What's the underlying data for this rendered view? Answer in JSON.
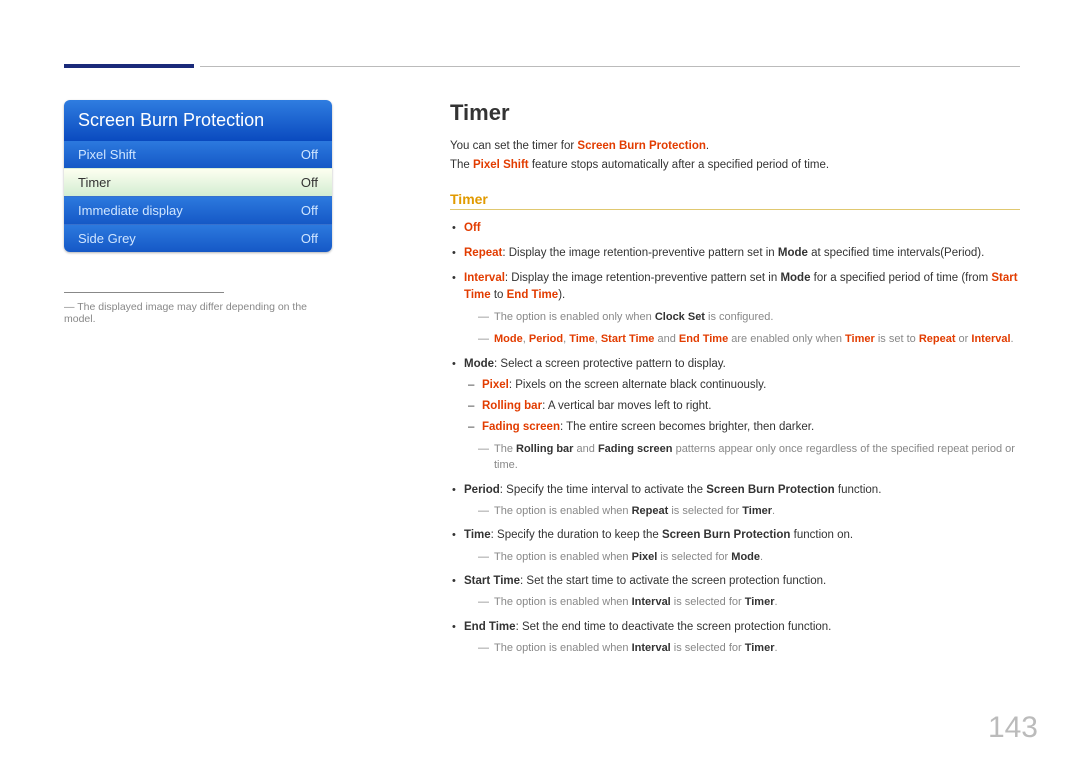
{
  "page_number": "143",
  "left": {
    "menu_title": "Screen Burn Protection",
    "rows": [
      {
        "label": "Pixel Shift",
        "value": "Off",
        "selected": false
      },
      {
        "label": "Timer",
        "value": "Off",
        "selected": true
      },
      {
        "label": "Immediate display",
        "value": "Off",
        "selected": false
      },
      {
        "label": "Side Grey",
        "value": "Off",
        "selected": false
      }
    ],
    "footnote": "The displayed image may differ depending on the model."
  },
  "right": {
    "title": "Timer",
    "intro1_pre": "You can set the timer for ",
    "intro1_b": "Screen Burn Protection",
    "intro1_post": ".",
    "intro2_pre": "The ",
    "intro2_b": "Pixel Shift",
    "intro2_post": " feature stops automatically after a specified period of time.",
    "sub": "Timer",
    "off": "Off",
    "repeat_b": "Repeat",
    "repeat_t1": ": Display the image retention-preventive pattern set in ",
    "repeat_m": "Mode",
    "repeat_t2": " at specified time intervals(Period).",
    "interval_b": "Interval",
    "interval_t1": ": Display the image retention-preventive pattern set in ",
    "interval_m": "Mode",
    "interval_t2": " for a specified period of time (from ",
    "interval_st": "Start Time",
    "interval_t3": " to ",
    "interval_et": "End Time",
    "interval_t4": ").",
    "note_clock_pre": "The option is enabled only when ",
    "note_clock_b": "Clock Set",
    "note_clock_post": " is configured.",
    "note_enabled_m": "Mode",
    "note_enabled_sep": ", ",
    "note_enabled_p": "Period",
    "note_enabled_t": "Time",
    "note_enabled_st": "Start Time",
    "note_enabled_and": " and ",
    "note_enabled_et": "End Time",
    "note_enabled_mid": " are enabled only when ",
    "note_enabled_timer": "Timer",
    "note_enabled_mid2": " is set to ",
    "note_enabled_r": "Repeat",
    "note_enabled_or": " or ",
    "note_enabled_i": "Interval",
    "note_enabled_end": ".",
    "mode_b": "Mode",
    "mode_text": ": Select a screen protective pattern to display.",
    "pixel_b": "Pixel",
    "pixel_text": ": Pixels on the screen alternate black continuously.",
    "rolling_b": "Rolling bar",
    "rolling_text": ": A vertical bar moves left to right.",
    "fading_b": "Fading screen",
    "fading_text": ": The entire screen becomes brighter, then darker.",
    "note_rf_pre": "The ",
    "note_rf_r": "Rolling bar",
    "note_rf_and": " and ",
    "note_rf_f": "Fading screen",
    "note_rf_post": " patterns appear only once regardless of the specified repeat period or time.",
    "period_b": "Period",
    "period_t1": ": Specify the time interval to activate the ",
    "period_sbp": "Screen Burn Protection",
    "period_t2": " function.",
    "note_period_pre": "The option is enabled when ",
    "note_period_r": "Repeat",
    "note_period_mid": " is selected for ",
    "note_period_t": "Timer",
    "note_period_end": ".",
    "time_b": "Time",
    "time_t1": ": Specify the duration to keep the ",
    "time_sbp": "Screen Burn Protection",
    "time_t2": " function on.",
    "note_time_pre": "The option is enabled when ",
    "note_time_p": "Pixel",
    "note_time_mid": " is selected for ",
    "note_time_m": "Mode",
    "note_time_end": ".",
    "start_b": "Start Time",
    "start_text": ": Set the start time to activate the screen protection function.",
    "note_start_pre": "The option is enabled when ",
    "note_start_i": "Interval",
    "note_start_mid": " is selected for ",
    "note_start_t": "Timer",
    "note_start_end": ".",
    "end_b": "End Time",
    "end_text": ": Set the end time to deactivate the screen protection function.",
    "note_end_pre": "The option is enabled when ",
    "note_end_i": "Interval",
    "note_end_mid": " is selected for ",
    "note_end_t": "Timer",
    "note_end_end": "."
  }
}
